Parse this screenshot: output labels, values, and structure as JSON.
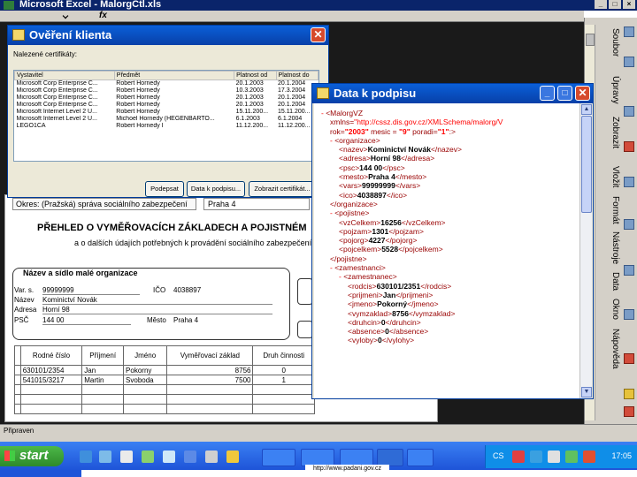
{
  "excel": {
    "title": "Microsoft Excel - MalorgCtl.xls",
    "formula_prefix": "fx",
    "status": "Připraven"
  },
  "right_pane": {
    "tabs": [
      "Soubor",
      "Úpravy",
      "Zobrazit",
      "Vložit",
      "Formát",
      "Nástroje",
      "Data",
      "Okno",
      "Nápověda"
    ]
  },
  "dialog_klient": {
    "title": "Ověření klienta",
    "subtitle": "Nalezené certifikáty:",
    "columns": [
      "Vystavitel",
      "Předmět",
      "Platnost od",
      "Platnost do"
    ],
    "rows": [
      [
        "Microsoft Corp Enterprise C...",
        "Robert Hornedy",
        "20.1.2003",
        "20.1.2004"
      ],
      [
        "Microsoft Corp Enterprise C...",
        "Robert Hornedy",
        "10.3.2003",
        "17.3.2004"
      ],
      [
        "Microsoft Corp Enterprise C...",
        "Robert Hornedy",
        "20.1.2003",
        "20.1.2004"
      ],
      [
        "Microsoft Corp Enterprise C...",
        "Robert Hornedy",
        "20.1.2003",
        "20.1.2004"
      ],
      [
        "Microsoft Internet Level 2 U...",
        "Robert Hornedy",
        "15.11.200...",
        "15.11.200..."
      ],
      [
        "Microsoft Internet Level 2 U...",
        "Michoel Hornedy (HEGENBARTO...",
        "6.1.2003",
        "6.1.2004"
      ],
      [
        "LEGO1CA",
        "Robert Hornedy I",
        "11.12.200...",
        "11.12.200..."
      ]
    ],
    "buttons": {
      "podepsat": "Podepsat",
      "data_k_podpisu": "Data k podpisu...",
      "zobrazit_cert": "Zobrazit certifikát..."
    }
  },
  "dialog_data": {
    "title": "Data k podpisu",
    "lines": [
      {
        "indent": 0,
        "parts": [
          [
            "m",
            "- "
          ],
          [
            "t",
            "<MalorgVZ"
          ]
        ]
      },
      {
        "indent": 1,
        "parts": [
          [
            "t",
            "xmlns="
          ],
          [
            "u",
            "\"http://cssz.dis.gov.cz/XMLSchema/malorg/V"
          ]
        ]
      },
      {
        "indent": 1,
        "parts": [
          [
            "t",
            "rok="
          ],
          [
            "a",
            "\"2003\""
          ],
          [
            "t",
            " mesic = "
          ],
          [
            "a",
            "\"9\""
          ],
          [
            "t",
            " poradi="
          ],
          [
            "a",
            "\"1\""
          ],
          [
            "t",
            ":>"
          ]
        ]
      },
      {
        "indent": 1,
        "parts": [
          [
            "m",
            "- "
          ],
          [
            "t",
            "<organizace>"
          ]
        ]
      },
      {
        "indent": 2,
        "parts": [
          [
            "t",
            "<nazev>"
          ],
          [
            "v",
            "Kominictví Novák"
          ],
          [
            "t",
            "</nazev>"
          ]
        ]
      },
      {
        "indent": 2,
        "parts": [
          [
            "t",
            "<adresa>"
          ],
          [
            "v",
            "Horní 98"
          ],
          [
            "t",
            "</adresa>"
          ]
        ]
      },
      {
        "indent": 2,
        "parts": [
          [
            "t",
            "<psc>"
          ],
          [
            "v",
            "144 00"
          ],
          [
            "t",
            "</psc>"
          ]
        ]
      },
      {
        "indent": 2,
        "parts": [
          [
            "t",
            "<mesto>"
          ],
          [
            "v",
            "Praha 4"
          ],
          [
            "t",
            "</mesto>"
          ]
        ]
      },
      {
        "indent": 2,
        "parts": [
          [
            "t",
            "<vars>"
          ],
          [
            "v",
            "99999999"
          ],
          [
            "t",
            "</vars>"
          ]
        ]
      },
      {
        "indent": 2,
        "parts": [
          [
            "t",
            "<ico>"
          ],
          [
            "v",
            "4038897"
          ],
          [
            "t",
            "</ico>"
          ]
        ]
      },
      {
        "indent": 1,
        "parts": [
          [
            "t",
            "</organizace>"
          ]
        ]
      },
      {
        "indent": 1,
        "parts": [
          [
            "m",
            "- "
          ],
          [
            "t",
            "<pojistne>"
          ]
        ]
      },
      {
        "indent": 2,
        "parts": [
          [
            "t",
            "<vzCelkem>"
          ],
          [
            "v",
            "16256"
          ],
          [
            "t",
            "</vzCelkem>"
          ]
        ]
      },
      {
        "indent": 2,
        "parts": [
          [
            "t",
            "<pojzam>"
          ],
          [
            "v",
            "1301"
          ],
          [
            "t",
            "</pojzam>"
          ]
        ]
      },
      {
        "indent": 2,
        "parts": [
          [
            "t",
            "<pojorg>"
          ],
          [
            "v",
            "4227"
          ],
          [
            "t",
            "</pojorg>"
          ]
        ]
      },
      {
        "indent": 2,
        "parts": [
          [
            "t",
            "<pojcelkem>"
          ],
          [
            "v",
            "5528"
          ],
          [
            "t",
            "</pojcelkem>"
          ]
        ]
      },
      {
        "indent": 1,
        "parts": [
          [
            "t",
            "</pojistne>"
          ]
        ]
      },
      {
        "indent": 1,
        "parts": [
          [
            "m",
            "- "
          ],
          [
            "t",
            "<zamestnanci>"
          ]
        ]
      },
      {
        "indent": 2,
        "parts": [
          [
            "m",
            "- "
          ],
          [
            "t",
            "<zamestnanec>"
          ]
        ]
      },
      {
        "indent": 3,
        "parts": [
          [
            "t",
            "<rodcis>"
          ],
          [
            "v",
            "630101/2351"
          ],
          [
            "t",
            "</rodcis>"
          ]
        ]
      },
      {
        "indent": 3,
        "parts": [
          [
            "t",
            "<prijmeni>"
          ],
          [
            "v",
            "Jan"
          ],
          [
            "t",
            "</prijmeni>"
          ]
        ]
      },
      {
        "indent": 3,
        "parts": [
          [
            "t",
            "<jmeno>"
          ],
          [
            "v",
            "Pokorný"
          ],
          [
            "t",
            "</jmeno>"
          ]
        ]
      },
      {
        "indent": 3,
        "parts": [
          [
            "t",
            "<vymzaklad>"
          ],
          [
            "v",
            "8756"
          ],
          [
            "t",
            "</vymzaklad>"
          ]
        ]
      },
      {
        "indent": 3,
        "parts": [
          [
            "t",
            "<druhcin>"
          ],
          [
            "v",
            "0"
          ],
          [
            "t",
            "</druhcin>"
          ]
        ]
      },
      {
        "indent": 3,
        "parts": [
          [
            "t",
            "<absence>"
          ],
          [
            "v",
            "0"
          ],
          [
            "t",
            "</absence>"
          ]
        ]
      },
      {
        "indent": 3,
        "parts": [
          [
            "t",
            "<vyloby>"
          ],
          [
            "v",
            "0"
          ],
          [
            "t",
            "</vylohy>"
          ]
        ]
      }
    ]
  },
  "sheet": {
    "okres_label": "Okres: (Pražská) správa sociálního zabezpečení",
    "okres_value": "Praha 4",
    "heading": "PŘEHLED O VYMĚŘOVACÍCH ZÁKLADECH A POJISTNÉM",
    "subheading": "a o dalších údajích potřebných k provádění sociálního zabezpečení",
    "org_heading": "Název a sídlo malé organizace",
    "fields": {
      "vs_label": "Var. s.",
      "vs_value": "99999999",
      "nazev_label": "Název",
      "nazev_value": "Kominictví Novák",
      "adresa_label": "Adresa",
      "adresa_value": "Horní 98",
      "psc_label": "PSČ",
      "psc_value": "144 00",
      "ico_label": "IČO",
      "ico_value": "4038897",
      "mesto_label": "Město",
      "mesto_value": "Praha 4"
    },
    "table_headers": [
      "Rodné číslo",
      "Příjmení",
      "Jméno",
      "Vyměřovací základ",
      "Druh činnosti"
    ],
    "rows": [
      [
        "630101/2354",
        "Jan",
        "Pokorny",
        "8756",
        "0"
      ],
      [
        "541015/3217",
        "Martin",
        "Svoboda",
        "7500",
        "1"
      ],
      [
        "",
        "",
        "",
        "",
        ""
      ],
      [
        "",
        "",
        "",
        "",
        ""
      ],
      [
        "",
        "",
        "",
        "",
        ""
      ]
    ]
  },
  "taskbar": {
    "start": "start",
    "clock": "17:05",
    "lang": "CS",
    "url": "http://www.padani.gov.cz"
  }
}
